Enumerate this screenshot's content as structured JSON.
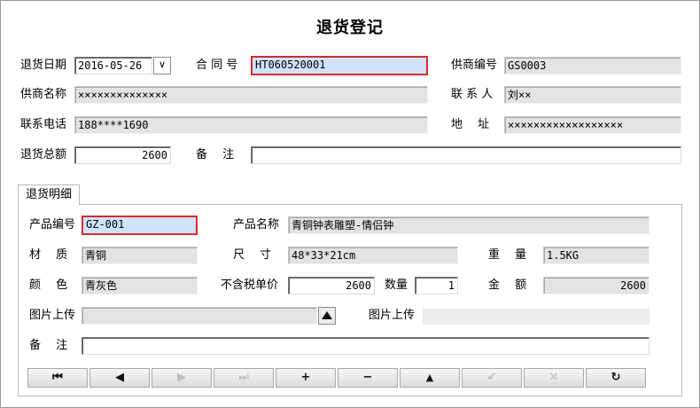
{
  "title": "退货登记",
  "header": {
    "return_date_label": "退货日期",
    "return_date_value": "2016-05-26",
    "date_dropdown_glyph": "∨",
    "contract_no_label": "合 同 号",
    "contract_no_value": "HT060520001",
    "supplier_code_label": "供商编号",
    "supplier_code_value": "GS0003",
    "supplier_name_label": "供商名称",
    "supplier_name_value": "××××××××××××××",
    "contact_label": "联 系 人",
    "contact_value": "刘××",
    "phone_label": "联系电话",
    "phone_value": "188****1690",
    "address_label": "地　 址",
    "address_value": "××××××××××××××××××",
    "total_label": "退货总额",
    "total_value": "2600",
    "remark_label": "备　 注",
    "remark_value": ""
  },
  "detail_tab_label": "退货明细",
  "detail": {
    "product_code_label": "产品编号",
    "product_code_value": "GZ-001",
    "product_name_label": "产品名称",
    "product_name_value": "青铜钟表雕塑-情侣钟",
    "material_label": "材　 质",
    "material_value": "青铜",
    "size_label": "尺　 寸",
    "size_value": "48*33*21cm",
    "weight_label": "重　 量",
    "weight_value": "1.5KG",
    "color_label": "颜　 色",
    "color_value": "青灰色",
    "price_label": "不含税单价",
    "price_value": "2600",
    "qty_label": "数量",
    "qty_value": "1",
    "amount_label": "金　 额",
    "amount_value": "2600",
    "image_upload_label": "图片上传",
    "image_upload_value": "",
    "image_upload_label2": "图片上传",
    "remark_label": "备　 注",
    "remark_value": ""
  },
  "nav": {
    "first": "⏮",
    "prev": "◀",
    "next": "▶",
    "last": "⏭",
    "add": "+",
    "delete": "−",
    "edit": "▲",
    "post": "✔",
    "cancel": "✕",
    "refresh": "↻"
  }
}
